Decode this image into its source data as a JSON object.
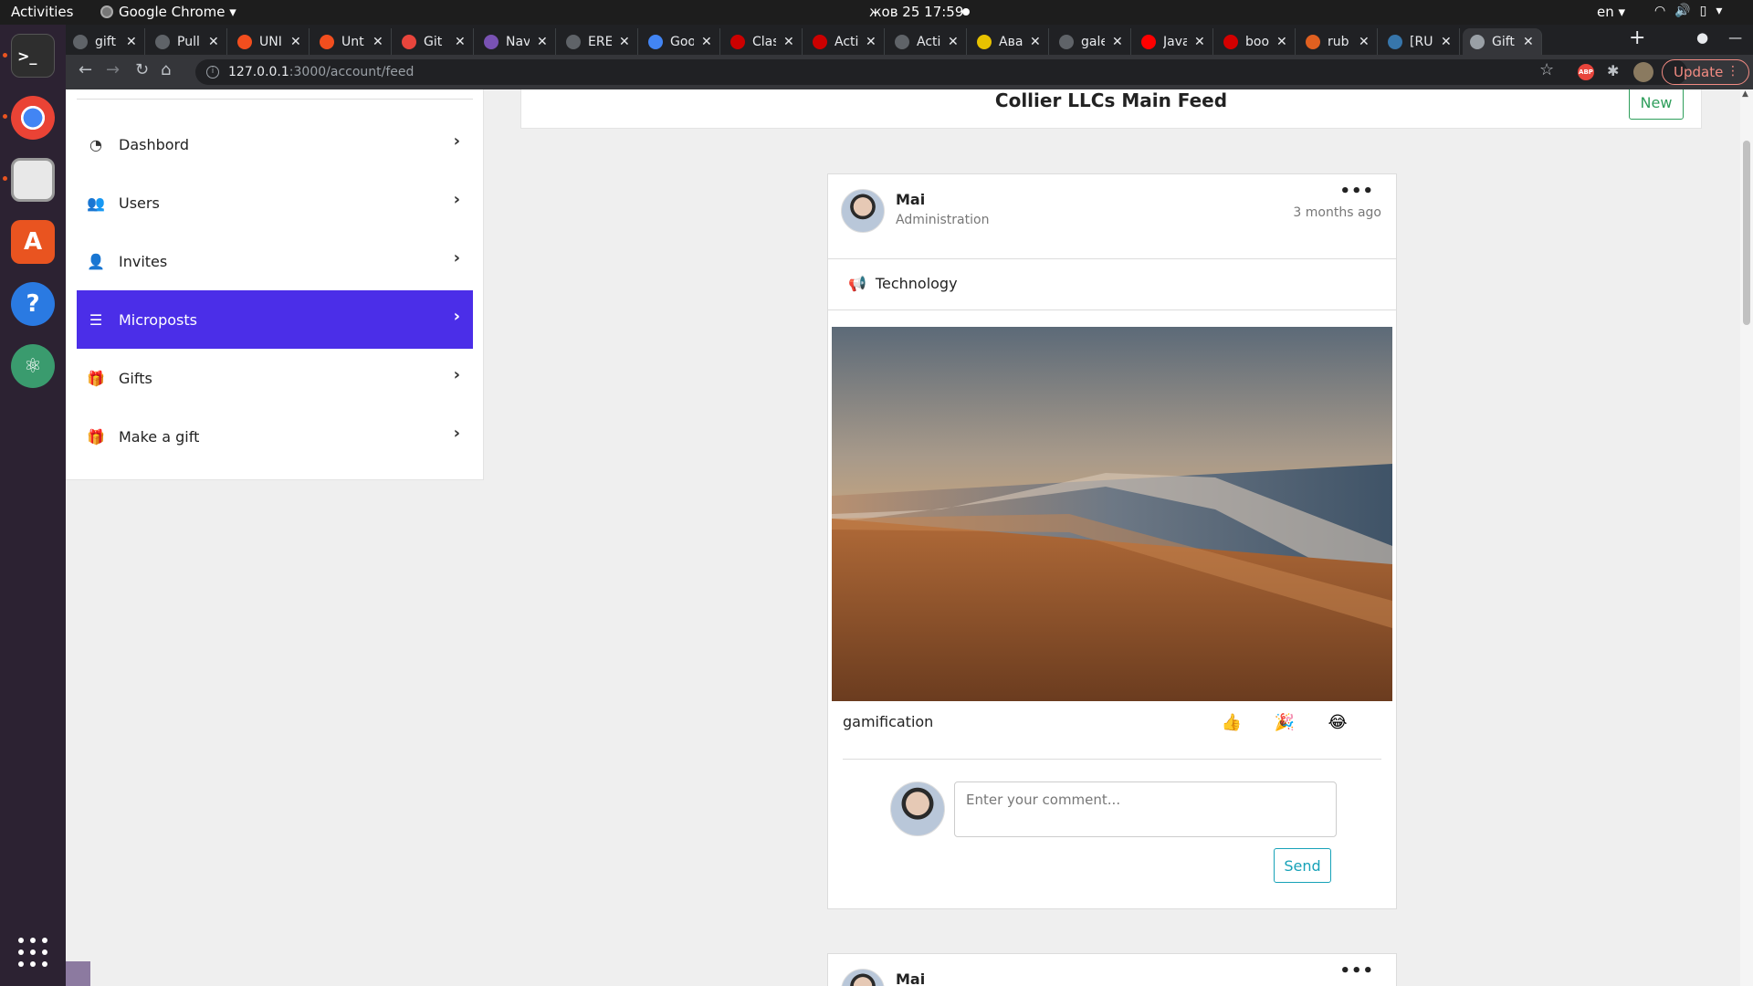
{
  "system_bar": {
    "activities": "Activities",
    "app_name": "Google Chrome ▾",
    "clock": "жов 25  17:59",
    "language": "en ▾"
  },
  "tabs": [
    {
      "label": "gift",
      "color": "#5f6368"
    },
    {
      "label": "Pull",
      "color": "#5f6368"
    },
    {
      "label": "UNI",
      "color": "#f24e1e"
    },
    {
      "label": "Unt",
      "color": "#f24e1e"
    },
    {
      "label": "Git",
      "color": "#e8453c"
    },
    {
      "label": "Nav",
      "color": "#7952b3"
    },
    {
      "label": "ERE",
      "color": "#5f6368"
    },
    {
      "label": "Goo",
      "color": "#4285f4"
    },
    {
      "label": "Clas",
      "color": "#cc0000"
    },
    {
      "label": "Acti",
      "color": "#cc0000"
    },
    {
      "label": "Acti",
      "color": "#5f6368"
    },
    {
      "label": "Ава",
      "color": "#e8c200"
    },
    {
      "label": "gale",
      "color": "#5f6368"
    },
    {
      "label": "Java",
      "color": "#ff0000"
    },
    {
      "label": "boo",
      "color": "#d40000"
    },
    {
      "label": "rub",
      "color": "#e06020"
    },
    {
      "label": "[RU",
      "color": "#3776ab"
    },
    {
      "label": "Gift",
      "color": "#9aa0a6"
    }
  ],
  "browser": {
    "url_host": "127.0.0.1",
    "url_path": ":3000/account/feed",
    "update_label": "Update",
    "ext_abp": "ABP"
  },
  "sidebar": {
    "items": [
      {
        "label": "Dashbord",
        "icon": "tachometer-icon"
      },
      {
        "label": "Users",
        "icon": "users-icon"
      },
      {
        "label": "Invites",
        "icon": "user-plus-icon"
      },
      {
        "label": "Microposts",
        "icon": "list-icon",
        "active": true
      },
      {
        "label": "Gifts",
        "icon": "gift-icon"
      },
      {
        "label": "Make a gift",
        "icon": "gifts-icon"
      }
    ]
  },
  "feed": {
    "title": "Collier LLCs Main Feed",
    "new_label": "New"
  },
  "posts": [
    {
      "author": "Mai",
      "department": "Administration",
      "time": "3 months ago",
      "category": "Technology",
      "body": "gamification",
      "reactions": [
        "👍",
        "🎉",
        "😂"
      ],
      "comment_placeholder": "Enter your comment...",
      "send_label": "Send"
    },
    {
      "author": "Mai"
    }
  ],
  "colors": {
    "accent": "#4b2ee8",
    "new_button": "#2e9e5b",
    "send_button": "#17a2b8"
  }
}
